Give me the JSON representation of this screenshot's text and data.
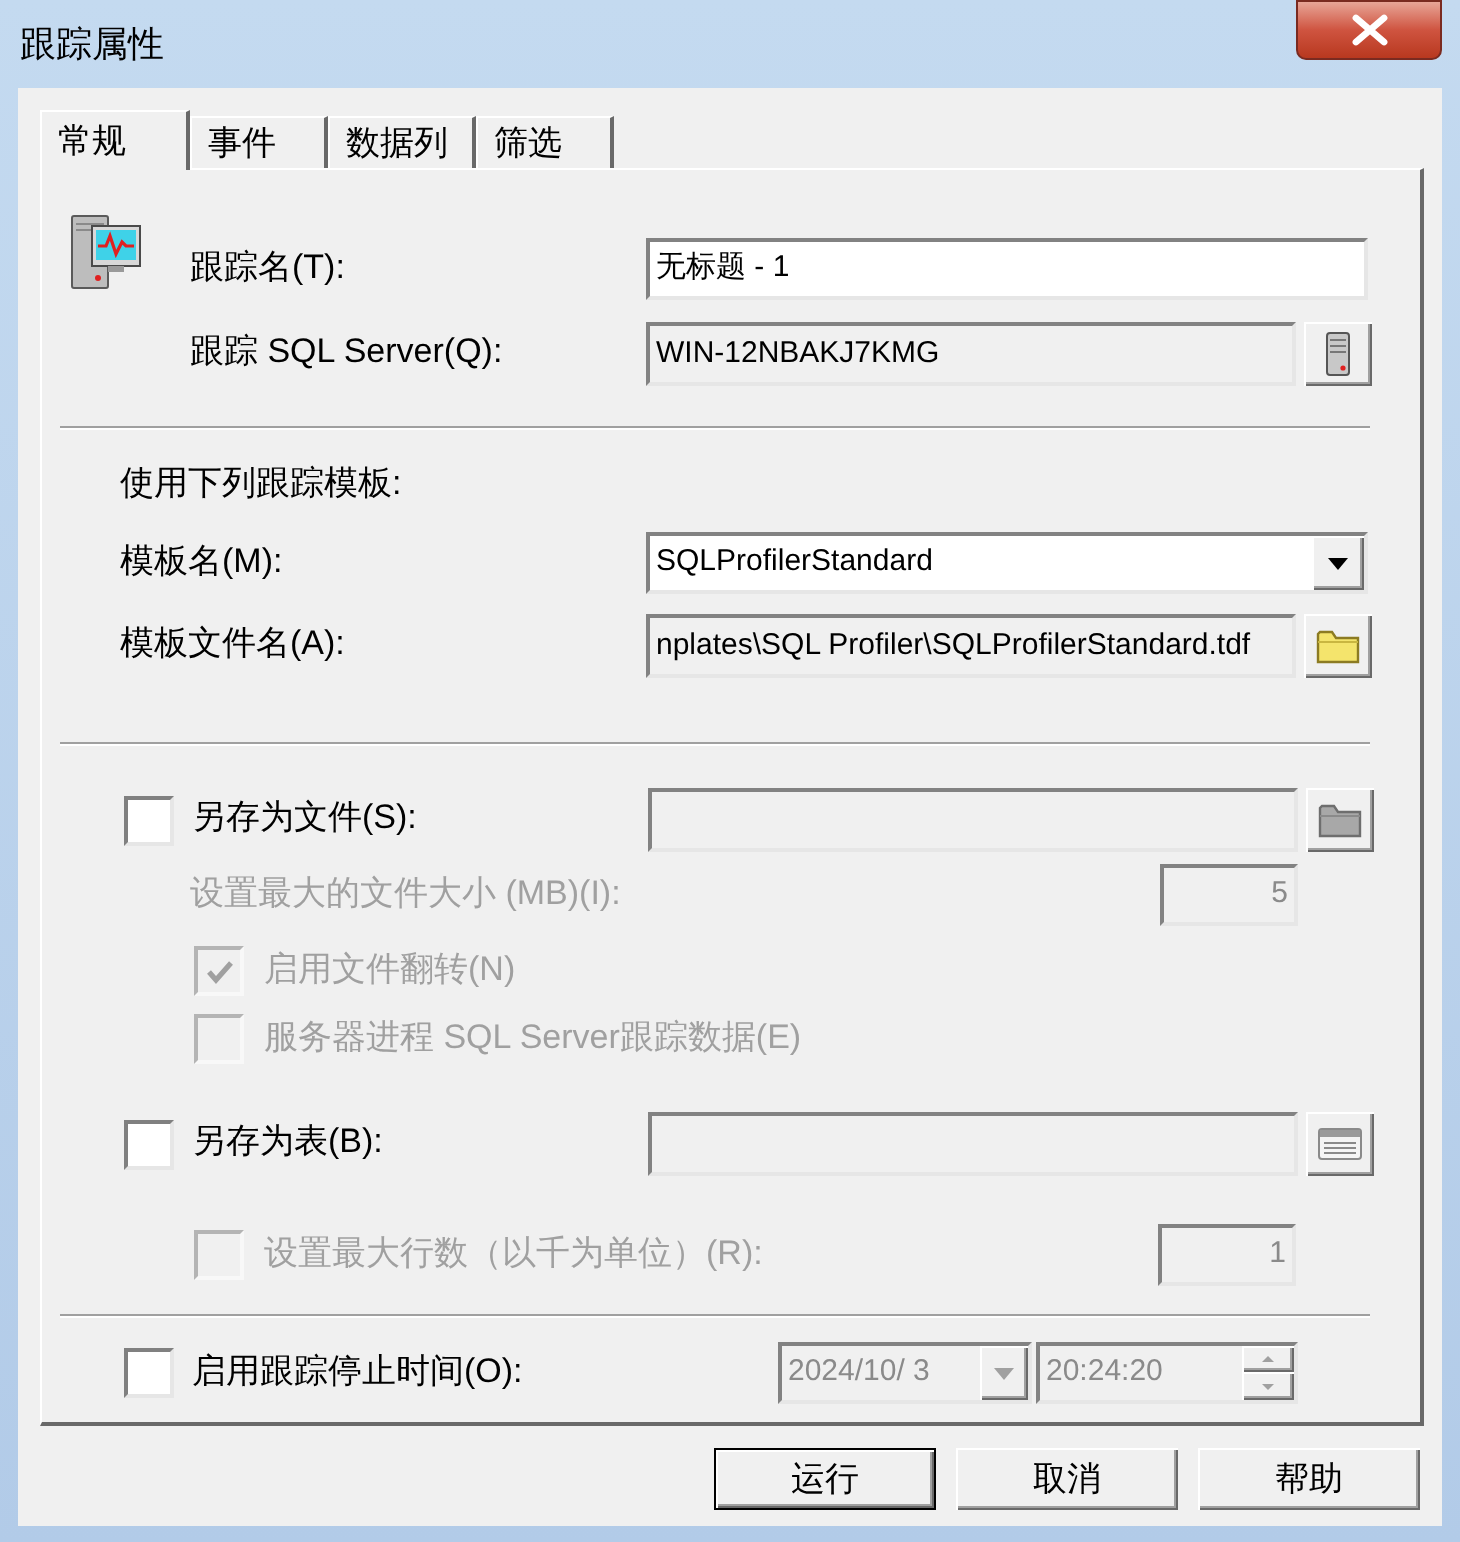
{
  "window": {
    "title": "跟踪属性"
  },
  "tabs": [
    {
      "label": "常规",
      "selected": true
    },
    {
      "label": "事件",
      "selected": false
    },
    {
      "label": "数据列",
      "selected": false
    },
    {
      "label": "筛选",
      "selected": false
    }
  ],
  "general": {
    "trace_name": {
      "label": "跟踪名(T):",
      "value": "无标题 - 1"
    },
    "trace_server": {
      "label": "跟踪 SQL Server(Q):",
      "value": "WIN-12NBAKJ7KMG"
    },
    "template_heading": "使用下列跟踪模板:",
    "template_name": {
      "label": "模板名(M):",
      "value": "SQLProfilerStandard"
    },
    "template_file": {
      "label": "模板文件名(A):",
      "value": "nplates\\SQL Profiler\\SQLProfilerStandard.tdf"
    },
    "save_to_file": {
      "label": "另存为文件(S):",
      "checked": false
    },
    "max_file_size": {
      "label": "设置最大的文件大小 (MB)(I):",
      "value": "5",
      "disabled": true
    },
    "file_rollover": {
      "label": "启用文件翻转(N)",
      "checked": true,
      "disabled": true
    },
    "server_processes": {
      "label": "服务器进程 SQL Server跟踪数据(E)",
      "checked": false,
      "disabled": true
    },
    "save_to_table": {
      "label": "另存为表(B):",
      "checked": false
    },
    "max_rows": {
      "label": "设置最大行数（以千为单位）(R):",
      "checked": false,
      "disabled": true,
      "value": "1"
    },
    "stop_time": {
      "label": "启用跟踪停止时间(O):",
      "checked": false,
      "date": "2024/10/ 3",
      "time": "20:24:20"
    }
  },
  "buttons": [
    {
      "label": "运行",
      "default": true
    },
    {
      "label": "取消",
      "default": false
    },
    {
      "label": "帮助",
      "default": false
    }
  ]
}
